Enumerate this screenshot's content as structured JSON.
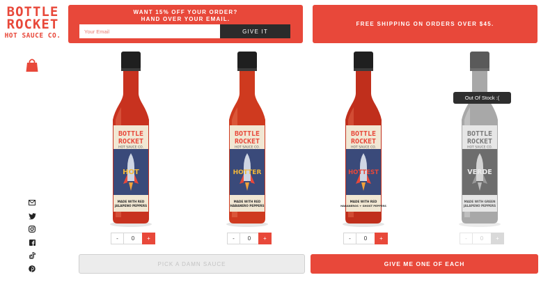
{
  "brand": {
    "line1": "BOTTLE",
    "line2": "ROCKET",
    "line3": "HOT SAUCE CO."
  },
  "colors": {
    "accent": "#e8483a",
    "dark": "#2b2b2b",
    "label_navy": "#3a4a7a",
    "label_cream": "#f1e7d3"
  },
  "header": {
    "promo_line1": "WANT 15% OFF YOUR ORDER?",
    "promo_line2": "HAND OVER YOUR EMAIL.",
    "email_placeholder": "Your Email",
    "email_value": "",
    "submit_label": "GIVE IT",
    "shipping_text": "FREE SHIPPING ON ORDERS OVER $45."
  },
  "sidebar": {
    "cart_icon": "shopping-bag-icon",
    "social_icons": [
      "email-icon",
      "twitter-icon",
      "instagram-icon",
      "facebook-icon",
      "tiktok-icon",
      "pinterest-icon"
    ]
  },
  "products": [
    {
      "label_brand_1": "BOTTLE",
      "label_brand_2": "ROCKET",
      "label_sub": "HOT SAUCE CO.",
      "heat": "HOT",
      "made_line1": "MADE WITH RED",
      "made_line2": "JALAPENO PEPPERS",
      "quantity": "0",
      "minus": "-",
      "plus": "+",
      "in_stock": true
    },
    {
      "label_brand_1": "BOTTLE",
      "label_brand_2": "ROCKET",
      "label_sub": "HOT SAUCE CO.",
      "heat": "HOTTER",
      "made_line1": "MADE WITH RED",
      "made_line2": "HABANERO PEPPERS",
      "quantity": "0",
      "minus": "-",
      "plus": "+",
      "in_stock": true
    },
    {
      "label_brand_1": "BOTTLE",
      "label_brand_2": "ROCKET",
      "label_sub": "HOT SAUCE CO.",
      "heat": "HOTTEST",
      "made_line1": "MADE WITH RED",
      "made_line2": "HABANEROS + GHOST PEPPERS",
      "quantity": "0",
      "minus": "-",
      "plus": "+",
      "in_stock": true
    },
    {
      "label_brand_1": "BOTTLE",
      "label_brand_2": "ROCKET",
      "label_sub": "HOT SAUCE CO.",
      "heat": "VERDE",
      "made_line1": "MADE WITH GREEN",
      "made_line2": "JALAPENO PEPPERS",
      "quantity": "0",
      "minus": "-",
      "plus": "+",
      "in_stock": false
    }
  ],
  "out_of_stock_tooltip": "Out Of Stock :(",
  "actions": {
    "pick_label": "PICK A DAMN SAUCE",
    "each_label": "GIVE ME ONE OF EACH"
  }
}
